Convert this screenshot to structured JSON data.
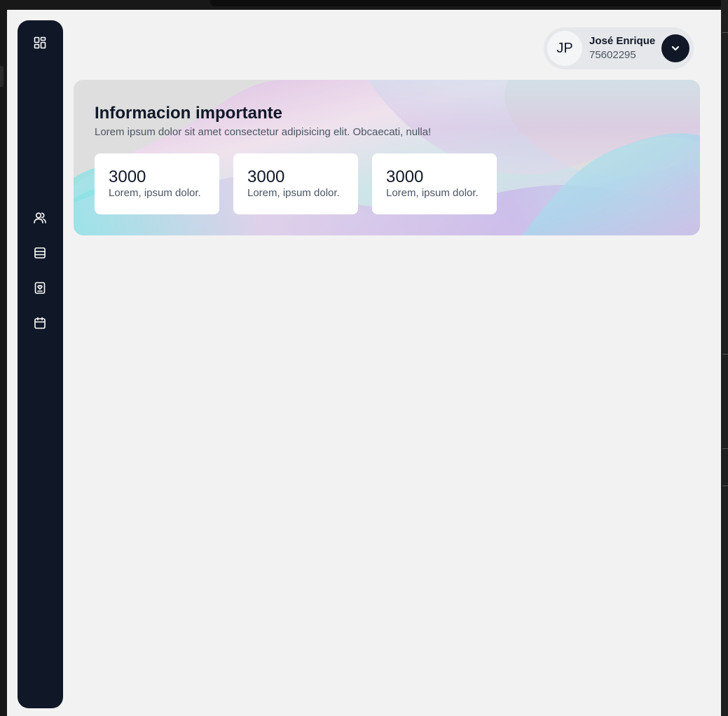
{
  "user": {
    "initials": "JP",
    "name": "José Enrique",
    "id": "75602295"
  },
  "banner": {
    "title": "Informacion importante",
    "subtitle": "Lorem ipsum dolor sit amet consectetur adipisicing elit. Obcaecati, nulla!"
  },
  "stats": [
    {
      "value": "3000",
      "label": "Lorem, ipsum dolor."
    },
    {
      "value": "3000",
      "label": "Lorem, ipsum dolor."
    },
    {
      "value": "3000",
      "label": "Lorem, ipsum dolor."
    }
  ],
  "sidebar": {
    "items": [
      {
        "icon": "dashboard-icon"
      },
      {
        "icon": "users-icon"
      },
      {
        "icon": "table-icon"
      },
      {
        "icon": "id-badge-icon"
      },
      {
        "icon": "calendar-icon"
      }
    ]
  },
  "colors": {
    "sidebar": "#101828",
    "background": "#f2f2f2",
    "card": "#ffffff",
    "chip": "#e6e7ea"
  }
}
